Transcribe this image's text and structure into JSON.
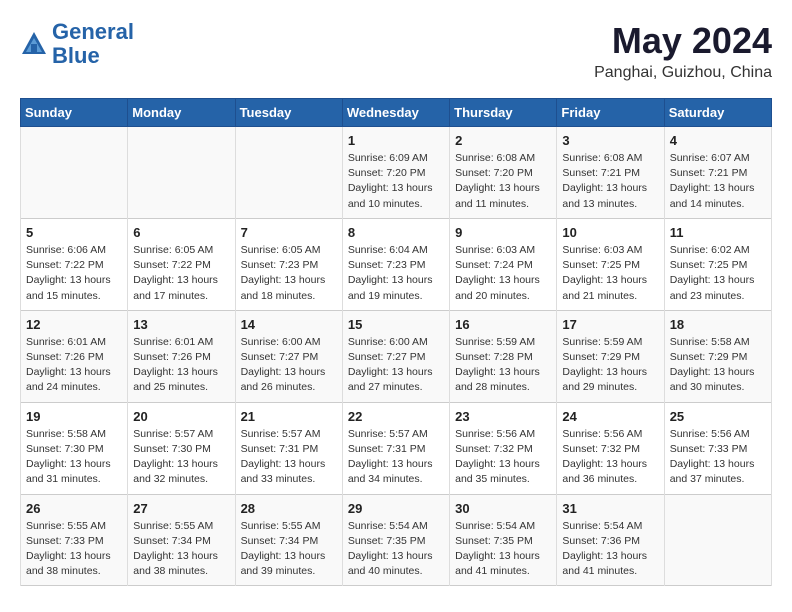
{
  "header": {
    "logo_line1": "General",
    "logo_line2": "Blue",
    "title": "May 2024",
    "subtitle": "Panghai, Guizhou, China"
  },
  "weekdays": [
    "Sunday",
    "Monday",
    "Tuesday",
    "Wednesday",
    "Thursday",
    "Friday",
    "Saturday"
  ],
  "weeks": [
    [
      {
        "day": "",
        "info": ""
      },
      {
        "day": "",
        "info": ""
      },
      {
        "day": "",
        "info": ""
      },
      {
        "day": "1",
        "info": "Sunrise: 6:09 AM\nSunset: 7:20 PM\nDaylight: 13 hours\nand 10 minutes."
      },
      {
        "day": "2",
        "info": "Sunrise: 6:08 AM\nSunset: 7:20 PM\nDaylight: 13 hours\nand 11 minutes."
      },
      {
        "day": "3",
        "info": "Sunrise: 6:08 AM\nSunset: 7:21 PM\nDaylight: 13 hours\nand 13 minutes."
      },
      {
        "day": "4",
        "info": "Sunrise: 6:07 AM\nSunset: 7:21 PM\nDaylight: 13 hours\nand 14 minutes."
      }
    ],
    [
      {
        "day": "5",
        "info": "Sunrise: 6:06 AM\nSunset: 7:22 PM\nDaylight: 13 hours\nand 15 minutes."
      },
      {
        "day": "6",
        "info": "Sunrise: 6:05 AM\nSunset: 7:22 PM\nDaylight: 13 hours\nand 17 minutes."
      },
      {
        "day": "7",
        "info": "Sunrise: 6:05 AM\nSunset: 7:23 PM\nDaylight: 13 hours\nand 18 minutes."
      },
      {
        "day": "8",
        "info": "Sunrise: 6:04 AM\nSunset: 7:23 PM\nDaylight: 13 hours\nand 19 minutes."
      },
      {
        "day": "9",
        "info": "Sunrise: 6:03 AM\nSunset: 7:24 PM\nDaylight: 13 hours\nand 20 minutes."
      },
      {
        "day": "10",
        "info": "Sunrise: 6:03 AM\nSunset: 7:25 PM\nDaylight: 13 hours\nand 21 minutes."
      },
      {
        "day": "11",
        "info": "Sunrise: 6:02 AM\nSunset: 7:25 PM\nDaylight: 13 hours\nand 23 minutes."
      }
    ],
    [
      {
        "day": "12",
        "info": "Sunrise: 6:01 AM\nSunset: 7:26 PM\nDaylight: 13 hours\nand 24 minutes."
      },
      {
        "day": "13",
        "info": "Sunrise: 6:01 AM\nSunset: 7:26 PM\nDaylight: 13 hours\nand 25 minutes."
      },
      {
        "day": "14",
        "info": "Sunrise: 6:00 AM\nSunset: 7:27 PM\nDaylight: 13 hours\nand 26 minutes."
      },
      {
        "day": "15",
        "info": "Sunrise: 6:00 AM\nSunset: 7:27 PM\nDaylight: 13 hours\nand 27 minutes."
      },
      {
        "day": "16",
        "info": "Sunrise: 5:59 AM\nSunset: 7:28 PM\nDaylight: 13 hours\nand 28 minutes."
      },
      {
        "day": "17",
        "info": "Sunrise: 5:59 AM\nSunset: 7:29 PM\nDaylight: 13 hours\nand 29 minutes."
      },
      {
        "day": "18",
        "info": "Sunrise: 5:58 AM\nSunset: 7:29 PM\nDaylight: 13 hours\nand 30 minutes."
      }
    ],
    [
      {
        "day": "19",
        "info": "Sunrise: 5:58 AM\nSunset: 7:30 PM\nDaylight: 13 hours\nand 31 minutes."
      },
      {
        "day": "20",
        "info": "Sunrise: 5:57 AM\nSunset: 7:30 PM\nDaylight: 13 hours\nand 32 minutes."
      },
      {
        "day": "21",
        "info": "Sunrise: 5:57 AM\nSunset: 7:31 PM\nDaylight: 13 hours\nand 33 minutes."
      },
      {
        "day": "22",
        "info": "Sunrise: 5:57 AM\nSunset: 7:31 PM\nDaylight: 13 hours\nand 34 minutes."
      },
      {
        "day": "23",
        "info": "Sunrise: 5:56 AM\nSunset: 7:32 PM\nDaylight: 13 hours\nand 35 minutes."
      },
      {
        "day": "24",
        "info": "Sunrise: 5:56 AM\nSunset: 7:32 PM\nDaylight: 13 hours\nand 36 minutes."
      },
      {
        "day": "25",
        "info": "Sunrise: 5:56 AM\nSunset: 7:33 PM\nDaylight: 13 hours\nand 37 minutes."
      }
    ],
    [
      {
        "day": "26",
        "info": "Sunrise: 5:55 AM\nSunset: 7:33 PM\nDaylight: 13 hours\nand 38 minutes."
      },
      {
        "day": "27",
        "info": "Sunrise: 5:55 AM\nSunset: 7:34 PM\nDaylight: 13 hours\nand 38 minutes."
      },
      {
        "day": "28",
        "info": "Sunrise: 5:55 AM\nSunset: 7:34 PM\nDaylight: 13 hours\nand 39 minutes."
      },
      {
        "day": "29",
        "info": "Sunrise: 5:54 AM\nSunset: 7:35 PM\nDaylight: 13 hours\nand 40 minutes."
      },
      {
        "day": "30",
        "info": "Sunrise: 5:54 AM\nSunset: 7:35 PM\nDaylight: 13 hours\nand 41 minutes."
      },
      {
        "day": "31",
        "info": "Sunrise: 5:54 AM\nSunset: 7:36 PM\nDaylight: 13 hours\nand 41 minutes."
      },
      {
        "day": "",
        "info": ""
      }
    ]
  ]
}
